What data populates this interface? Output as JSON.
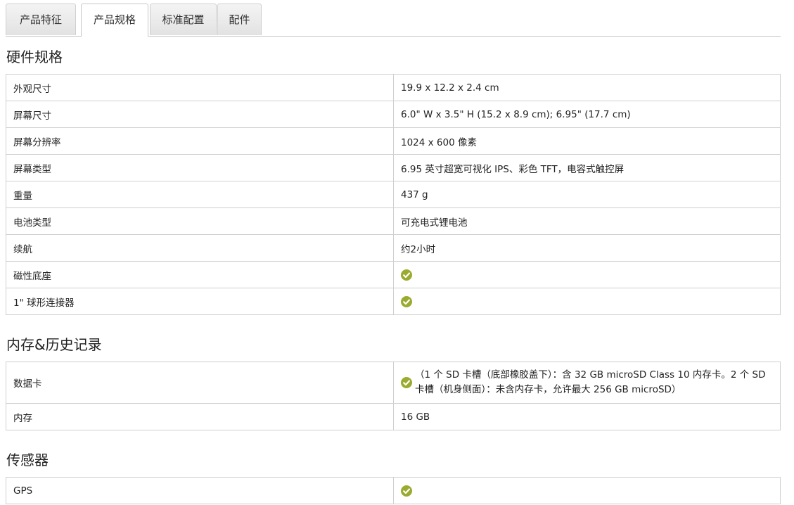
{
  "tabs": [
    {
      "label": "产品特征",
      "active": false
    },
    {
      "label": "产品规格",
      "active": true
    },
    {
      "label": "标准配置",
      "active": false
    },
    {
      "label": "配件",
      "active": false
    }
  ],
  "sections": [
    {
      "title": "硬件规格",
      "rows": [
        {
          "label": "外观尺寸",
          "value": "19.9 x 12.2 x 2.4 cm"
        },
        {
          "label": "屏幕尺寸",
          "value": "6.0\" W x 3.5\" H (15.2 x 8.9 cm); 6.95\" (17.7 cm)"
        },
        {
          "label": "屏幕分辨率",
          "value": "1024 x 600 像素"
        },
        {
          "label": "屏幕类型",
          "value": "6.95 英寸超宽可视化 IPS、彩色 TFT，电容式触控屏"
        },
        {
          "label": "重量",
          "value": "437 g"
        },
        {
          "label": "电池类型",
          "value": "可充电式锂电池"
        },
        {
          "label": "续航",
          "value": "约2小时"
        },
        {
          "label": "磁性底座",
          "value": "",
          "check": true
        },
        {
          "label": "1\" 球形连接器",
          "value": "",
          "check": true
        }
      ]
    },
    {
      "title": "内存&历史记录",
      "rows": [
        {
          "label": "数据卡",
          "value": "（1 个 SD 卡槽（底部橡胶盖下）：含 32 GB microSD Class 10 内存卡。2 个 SD 卡槽（机身侧面）：未含内存卡，允许最大 256 GB microSD）",
          "check": true
        },
        {
          "label": "内存",
          "value": "16 GB"
        }
      ]
    },
    {
      "title": "传感器",
      "rows": [
        {
          "label": "GPS",
          "value": "",
          "check": true
        }
      ]
    }
  ],
  "colors": {
    "check": "#9aab2f",
    "border": "#cfcfcf"
  },
  "icons": {
    "check": "check-circle-icon"
  }
}
